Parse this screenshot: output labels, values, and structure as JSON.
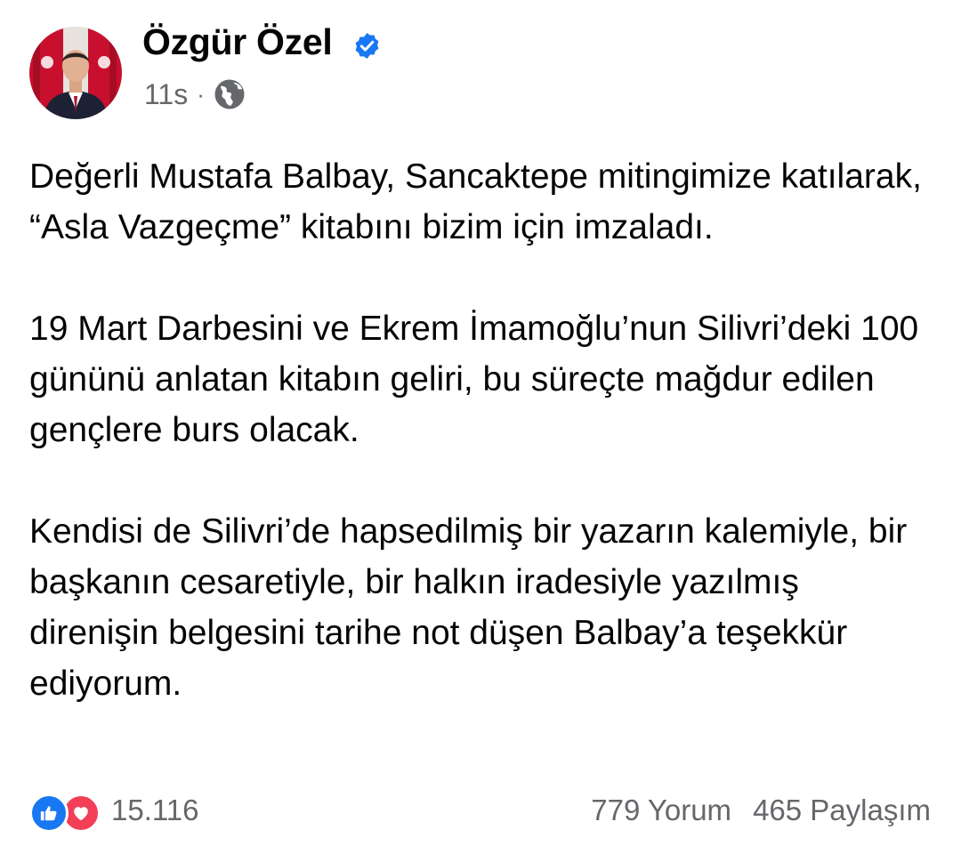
{
  "author": {
    "name": "Özgür Özel",
    "verified": true,
    "avatar": "person-portrait-with-flags"
  },
  "meta": {
    "time": "11s",
    "separator": "·",
    "audience_icon": "globe-icon"
  },
  "post": {
    "paragraphs": [
      "Değerli Mustafa Balbay, Sancaktepe mitingimize katılarak, “Asla Vazgeçme” kitabını bizim için imzaladı.",
      "19 Mart Darbesini ve Ekrem İmamoğlu’nun Silivri’deki 100 gününü anlatan kitabın geliri, bu süreçte mağdur edilen gençlere burs olacak.",
      "Kendisi de Silivri’de hapsedilmiş bir yazarın kalemiyle, bir başkanın cesaretiyle, bir halkın iradesiyle yazılmış direnişin belgesini tarihe not düşen Balbay’a teşekkür ediyorum."
    ]
  },
  "footer": {
    "reaction_icons": [
      "like-icon",
      "love-icon"
    ],
    "reaction_count": "15.116",
    "comments": "779 Yorum",
    "shares": "465 Paylaşım"
  },
  "colors": {
    "text_primary": "#050505",
    "text_secondary": "#65676b",
    "verified_blue": "#1877f2",
    "like_blue": "#1877f2",
    "love_red": "#f33e58"
  }
}
